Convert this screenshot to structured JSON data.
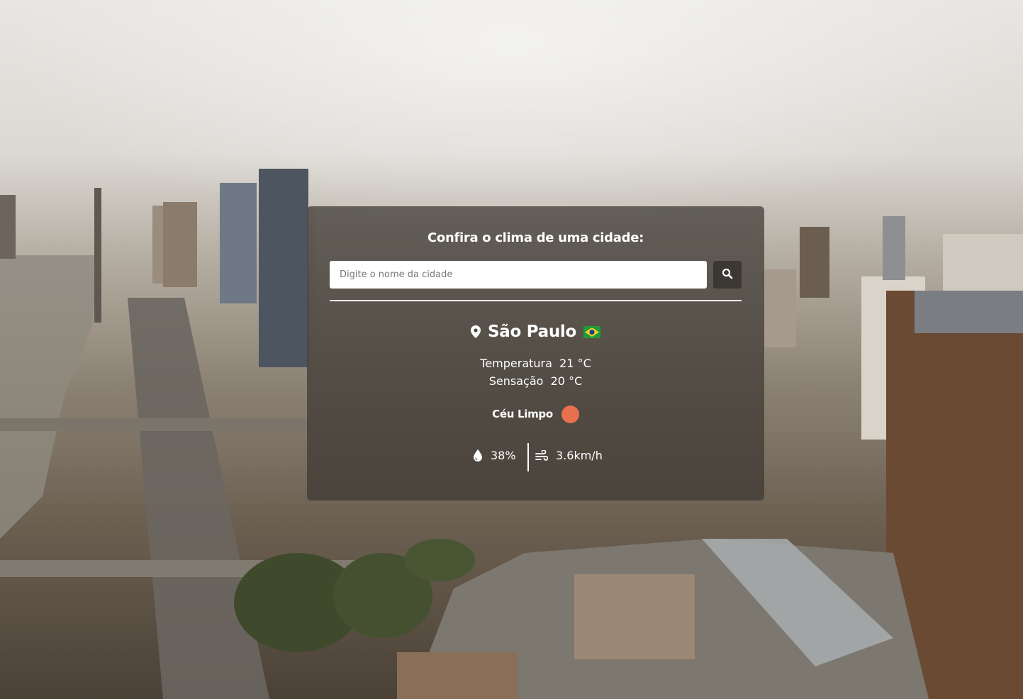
{
  "weather_card": {
    "title": "Confira o clima de uma cidade:",
    "search": {
      "placeholder": "Digite o nome da cidade",
      "value": ""
    },
    "city": {
      "name": "São Paulo",
      "country_flag": "brazil-flag-icon"
    },
    "temperature": {
      "label": "Temperatura",
      "value": "21",
      "unit": "°C"
    },
    "feels_like": {
      "label": "Sensação",
      "value": "20",
      "unit": "°C"
    },
    "condition": {
      "description": "Céu Limpo",
      "icon": "clear-sky-icon",
      "icon_color": "#e8704f"
    },
    "humidity": {
      "value": "38%",
      "icon": "droplet-icon"
    },
    "wind": {
      "value": "3.6km/h",
      "icon": "wind-icon"
    }
  },
  "colors": {
    "card_background": "#3c3732",
    "text": "#ffffff",
    "search_button": "#3b3833"
  }
}
